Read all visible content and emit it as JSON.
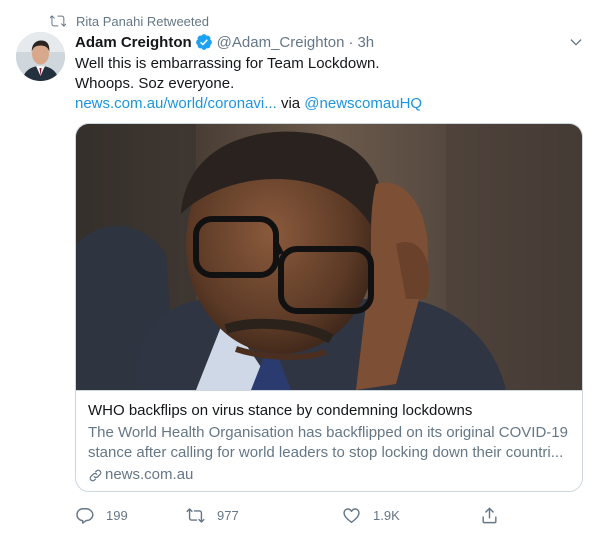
{
  "retweet_context": {
    "text": "Rita Panahi Retweeted",
    "icon": "retweet-icon"
  },
  "tweet": {
    "author": {
      "display_name": "Adam Creighton",
      "verified": true,
      "handle": "@Adam_Creighton",
      "separator": "·",
      "time": "3h"
    },
    "text_lines": [
      "Well this is embarrassing for Team Lockdown.",
      "Whoops. Soz everyone."
    ],
    "link_text": "news.com.au/world/coronavi...",
    "via_text": "via",
    "via_handle": "@newscomauHQ"
  },
  "card": {
    "title": "WHO backflips on virus stance by condemning lockdowns",
    "description_lines": [
      "The World Health Organisation has backflipped on its original COVID-19",
      "stance after calling for world leaders to stop locking down their countri..."
    ],
    "domain": "news.com.au"
  },
  "actions": {
    "reply_count": "199",
    "retweet_count": "977",
    "like_count": "1.9K"
  },
  "colors": {
    "accent": "#1b95e0",
    "verified": "#1da1f2",
    "secondary_text": "#657786",
    "primary_text": "#14171a",
    "border": "#ccd6dd"
  }
}
